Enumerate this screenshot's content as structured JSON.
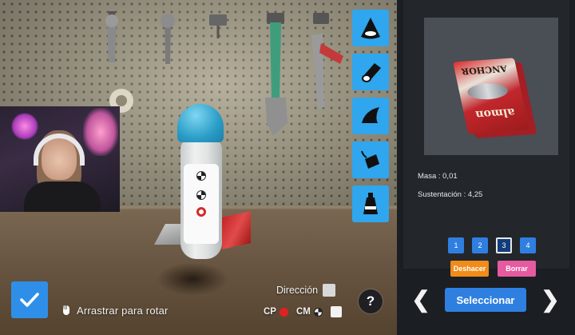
{
  "toolbar": {
    "tools": [
      {
        "icon": "cone-nose-icon"
      },
      {
        "icon": "cylinder-icon"
      },
      {
        "icon": "wing-fin-icon"
      },
      {
        "icon": "weight-icon"
      },
      {
        "icon": "bottle-icon"
      }
    ]
  },
  "controls": {
    "confirm_icon": "checkmark-icon",
    "rotate_hint": "Arrastrar para rotar",
    "direction_label": "Dirección",
    "cp_label": "CP",
    "cm_label": "CM",
    "help_label": "?"
  },
  "panel": {
    "preview_text_top": "ANCHOR",
    "preview_text_bottom": "almon",
    "mass_label": "Masa : 0,01",
    "lift_label": "Sustentación : 4,25",
    "slots": [
      "1",
      "2",
      "3",
      "4"
    ],
    "active_slot": "3",
    "undo_label": "Deshacer",
    "delete_label": "Borrar",
    "prev_arrow": "❮",
    "next_arrow": "❯",
    "select_label": "Seleccionar"
  },
  "colors": {
    "tool_button": "#2fa6ee",
    "confirm_button": "#2f8fe8",
    "select_button": "#2f7fe0",
    "undo_button": "#f08c19",
    "delete_button": "#e55aa0",
    "cp_marker": "#e02121",
    "panel_bg": "#1b1e22"
  }
}
